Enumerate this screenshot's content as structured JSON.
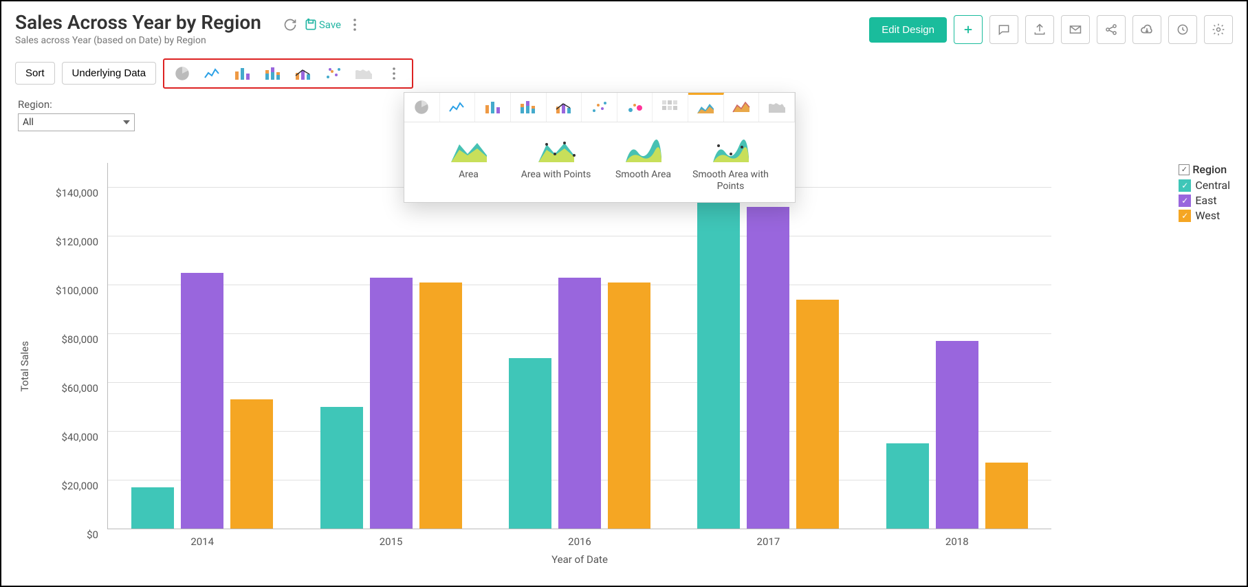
{
  "header": {
    "title": "Sales Across Year by Region",
    "subtitle": "Sales across Year (based on Date) by Region",
    "save_label": "Save",
    "edit_design_label": "Edit Design"
  },
  "toolbar": {
    "sort_label": "Sort",
    "underlying_label": "Underlying Data"
  },
  "filter": {
    "label": "Region:",
    "value": "All"
  },
  "popup": {
    "items": [
      {
        "label": "Area"
      },
      {
        "label": "Area with Points"
      },
      {
        "label": "Smooth Area"
      },
      {
        "label": "Smooth Area with Points"
      }
    ]
  },
  "legend": {
    "title": "Region",
    "items": [
      {
        "name": "Central",
        "color": "#3fc6b8"
      },
      {
        "name": "East",
        "color": "#9966dd"
      },
      {
        "name": "West",
        "color": "#f5a623"
      }
    ]
  },
  "chart_data": {
    "type": "bar",
    "title": "",
    "xlabel": "Year of Date",
    "ylabel": "Total Sales",
    "ylim": [
      0,
      150000
    ],
    "yticks": [
      0,
      20000,
      40000,
      60000,
      80000,
      100000,
      120000,
      140000
    ],
    "ytick_labels": [
      "$0",
      "$20,000",
      "$40,000",
      "$60,000",
      "$80,000",
      "$100,000",
      "$120,000",
      "$140,000"
    ],
    "categories": [
      "2014",
      "2015",
      "2016",
      "2017",
      "2018"
    ],
    "series": [
      {
        "name": "Central",
        "color": "#3fc6b8",
        "values": [
          17000,
          50000,
          70000,
          139000,
          35000
        ]
      },
      {
        "name": "East",
        "color": "#9966dd",
        "values": [
          105000,
          103000,
          103000,
          132000,
          77000
        ]
      },
      {
        "name": "West",
        "color": "#f5a623",
        "values": [
          53000,
          101000,
          101000,
          94000,
          27000
        ]
      }
    ]
  }
}
